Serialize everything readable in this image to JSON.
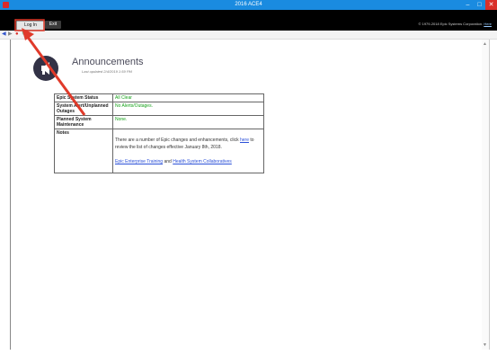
{
  "window": {
    "title": "2016 ACE4"
  },
  "menu": {
    "login_label": "Log In",
    "exit_label": "Exit"
  },
  "copyright": {
    "text": "© 1979-2018 Epic Systems Corporation.",
    "link": "Here"
  },
  "page": {
    "title": "Announcements",
    "updated": "Last updated 2/4/2019 1:59 PM"
  },
  "rows": [
    {
      "label": "Epic System Status",
      "value": "All Clear"
    },
    {
      "label": "System Alert/Unplanned Outages",
      "value": "No Alerts/Outages."
    },
    {
      "label": "Planned System Maintenance",
      "value": "None."
    }
  ],
  "notes": {
    "label": "Notes",
    "text_before": "There are a number of Epic changes and enhancements, click",
    "here_link": "here",
    "text_after": "to review the list of changes effective January 8th, 2018.",
    "training_link": "Epic Enterprise Training",
    "and_text": "and",
    "collab_link": "Health System Collaboratives"
  },
  "colors": {
    "accent": "#1a8be0",
    "ok": "#18a21c",
    "annotation": "#e03a2a"
  }
}
